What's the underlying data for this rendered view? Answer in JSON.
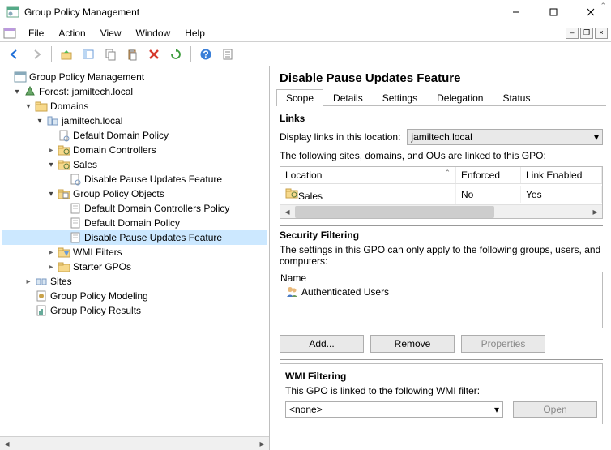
{
  "titlebar": {
    "title": "Group Policy Management"
  },
  "menu": {
    "file": "File",
    "action": "Action",
    "view": "View",
    "window": "Window",
    "help": "Help"
  },
  "tree": {
    "root": "Group Policy Management",
    "forest": "Forest: jamiltech.local",
    "domains": "Domains",
    "domain": "jamiltech.local",
    "ddp": "Default Domain Policy",
    "dc": "Domain Controllers",
    "sales": "Sales",
    "dpuf": "Disable Pause Updates Feature",
    "gpo": "Group Policy Objects",
    "ddcp": "Default Domain Controllers Policy",
    "ddp2": "Default Domain Policy",
    "dpuf2": "Disable Pause Updates Feature",
    "wmi": "WMI Filters",
    "starter": "Starter GPOs",
    "sites": "Sites",
    "gpm": "Group Policy Modeling",
    "gpr": "Group Policy Results"
  },
  "right": {
    "title": "Disable Pause Updates Feature",
    "tabs": {
      "scope": "Scope",
      "details": "Details",
      "settings": "Settings",
      "delegation": "Delegation",
      "status": "Status"
    },
    "links": {
      "heading": "Links",
      "display_label": "Display links in this location:",
      "location_value": "jamiltech.local",
      "linked_text": "The following sites, domains, and OUs are linked to this GPO:",
      "col_location": "Location",
      "col_enforced": "Enforced",
      "col_linkenabled": "Link Enabled",
      "row_location": "Sales",
      "row_enforced": "No",
      "row_linkenabled": "Yes"
    },
    "sec": {
      "heading": "Security Filtering",
      "desc": "The settings in this GPO can only apply to the following groups, users, and computers:",
      "col_name": "Name",
      "row_name": "Authenticated Users",
      "btn_add": "Add...",
      "btn_remove": "Remove",
      "btn_properties": "Properties"
    },
    "wmi": {
      "heading": "WMI Filtering",
      "desc": "This GPO is linked to the following WMI filter:",
      "value": "<none>",
      "btn_open": "Open"
    }
  }
}
